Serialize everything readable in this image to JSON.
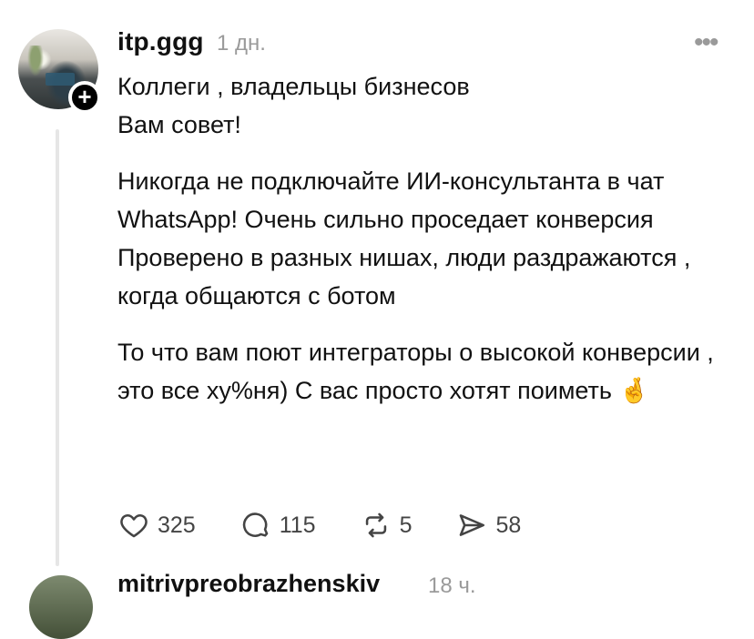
{
  "comment": {
    "username": "itp.ggg",
    "time": "1 дн.",
    "more_label": "•••",
    "add_label": "+",
    "lines": [
      "Коллеги , владельцы бизнесов",
      "Вам совет!",
      "Никогда не подключайте ИИ-консультанта в чат WhatsApp! Очень сильно проседает конверсия",
      "Проверено в разных нишах, люди раздражаются , когда общаются с ботом",
      "То что вам поют интеграторы о высокой конверсии , это все ху%ня)  С вас просто хотят поиметь 🤞"
    ],
    "actions": {
      "likes": "325",
      "replies": "115",
      "reposts": "5",
      "shares": "58"
    }
  },
  "next_comment": {
    "username": "mitrivpreobrazhenskiv",
    "time": "18 ч."
  }
}
